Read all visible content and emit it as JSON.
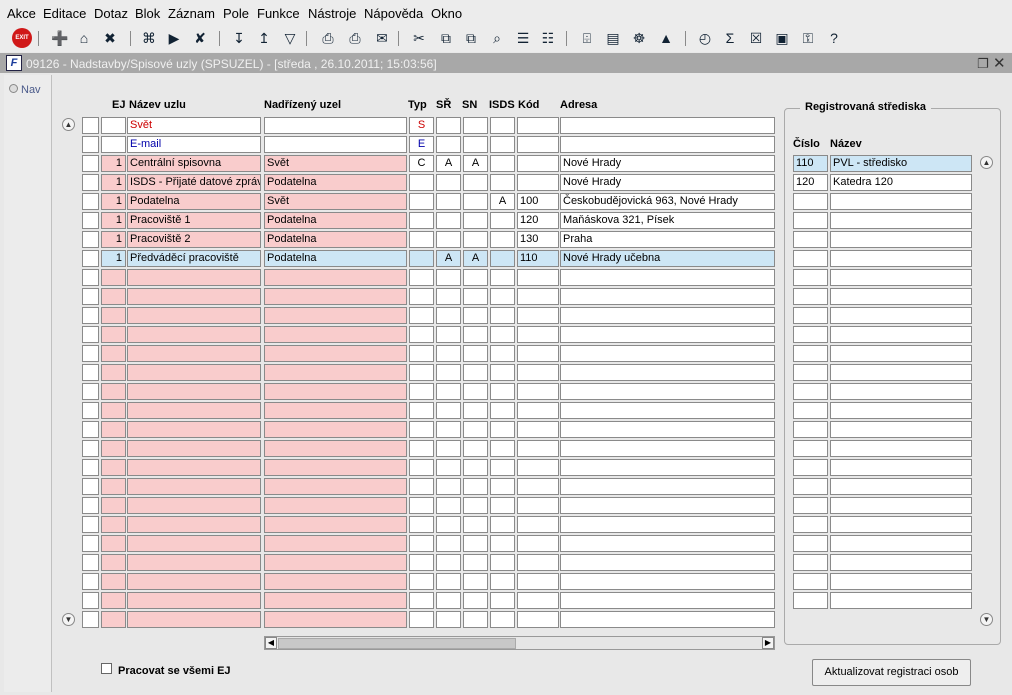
{
  "menu": [
    "Akce",
    "Editace",
    "Dotaz",
    "Blok",
    "Záznam",
    "Pole",
    "Funkce",
    "Nástroje",
    "Nápověda",
    "Okno"
  ],
  "window_title": "09126 - Nadstavby/Spisové uzly (SPSUZEL) - [středa , 26.10.2011; 15:03:56]",
  "nav_label": "Nav",
  "headers": {
    "ej": "EJ",
    "nazev": "Název uzlu",
    "nadrizeny": "Nadřízený uzel",
    "typ": "Typ",
    "sr": "SŘ",
    "sn": "SN",
    "isds": "ISDS",
    "kod": "Kód",
    "adresa": "Adresa"
  },
  "rows": [
    {
      "ej": "",
      "nazev": "Svět",
      "nadrizeny": "",
      "typ": "S",
      "sr": "",
      "sn": "",
      "isds": "",
      "kod": "",
      "adresa": "",
      "style": "red-plain"
    },
    {
      "ej": "",
      "nazev": "E-mail",
      "nadrizeny": "",
      "typ": "E",
      "sr": "",
      "sn": "",
      "isds": "",
      "kod": "",
      "adresa": "",
      "style": "blue-plain"
    },
    {
      "ej": "1",
      "nazev": "Centrální spisovna",
      "nadrizeny": "Svět",
      "typ": "C",
      "sr": "A",
      "sn": "A",
      "isds": "",
      "kod": "",
      "adresa": "Nové Hrady",
      "style": "pink"
    },
    {
      "ej": "1",
      "nazev": "ISDS - Přijaté datové zprávy",
      "nadrizeny": "Podatelna",
      "typ": "",
      "sr": "",
      "sn": "",
      "isds": "",
      "kod": "",
      "adresa": "Nové Hrady",
      "style": "pink"
    },
    {
      "ej": "1",
      "nazev": "Podatelna",
      "nadrizeny": "Svět",
      "typ": "",
      "sr": "",
      "sn": "",
      "isds": "A",
      "kod": "100",
      "adresa": "Českobudějovická 963, Nové Hrady",
      "style": "pink"
    },
    {
      "ej": "1",
      "nazev": "Pracoviště 1",
      "nadrizeny": "Podatelna",
      "typ": "",
      "sr": "",
      "sn": "",
      "isds": "",
      "kod": "120",
      "adresa": "Maňáskova 321, Písek",
      "style": "pink"
    },
    {
      "ej": "1",
      "nazev": "Pracoviště 2",
      "nadrizeny": "Podatelna",
      "typ": "",
      "sr": "",
      "sn": "",
      "isds": "",
      "kod": "130",
      "adresa": "Praha",
      "style": "pink"
    },
    {
      "ej": "1",
      "nazev": "Předváděcí pracoviště",
      "nadrizeny": "Podatelna",
      "typ": "",
      "sr": "A",
      "sn": "A",
      "isds": "",
      "kod": "110",
      "adresa": "Nové Hrady učebna",
      "style": "sel"
    }
  ],
  "empty_rows": 19,
  "reg": {
    "title": "Registrovaná střediska",
    "col_cislo": "Číslo",
    "col_nazev": "Název",
    "rows": [
      {
        "cislo": "110",
        "nazev": "PVL - středisko"
      },
      {
        "cislo": "120",
        "nazev": "Katedra 120"
      }
    ],
    "empty_rows": 22
  },
  "pracovat_label": "Pracovat se všemi EJ",
  "aktualizovat_label": "Aktualizovat registraci osob",
  "colors": {
    "pink": "#f9cccc",
    "selected": "#cde6f5",
    "red_text": "#c00000",
    "blue_text": "#0000aa"
  }
}
